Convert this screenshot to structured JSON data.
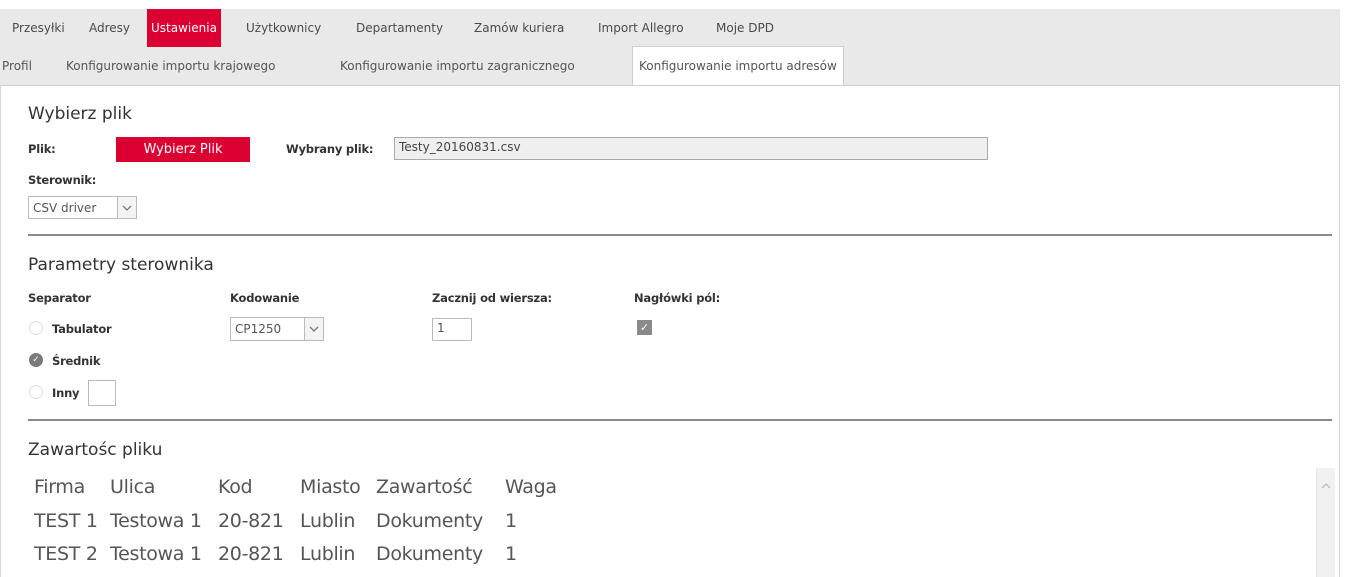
{
  "nav": {
    "items": [
      "Przesyłki",
      "Adresy",
      "Ustawienia",
      "Użytkownicy",
      "Departamenty",
      "Zamów kuriera",
      "Import Allegro",
      "Moje DPD"
    ],
    "active": "Ustawienia",
    "active_color": "#dc0032"
  },
  "subnav": {
    "items": [
      "Profil",
      "Konfigurowanie importu krajowego",
      "Konfigurowanie importu zagranicznego",
      "Konfigurowanie importu adresów"
    ],
    "active": "Konfigurowanie importu adresów"
  },
  "file_section": {
    "title": "Wybierz plik",
    "file_label": "Plik:",
    "choose_button": "Wybierz Plik",
    "selected_label": "Wybrany plik:",
    "selected_value": "Testy_20160831.csv",
    "driver_label": "Sterownik:",
    "driver_value": "CSV driver"
  },
  "params": {
    "title": "Parametry sterownika",
    "separator_label": "Separator",
    "separators": [
      {
        "label": "Tabulator",
        "checked": false
      },
      {
        "label": "Średnik",
        "checked": true
      },
      {
        "label": "Inny",
        "checked": false
      }
    ],
    "encoding_label": "Kodowanie",
    "encoding_value": "CP1250",
    "start_row_label": "Zacznij od wiersza:",
    "start_row_value": "1",
    "headers_label": "Nagłówki pól:",
    "headers_checked": true
  },
  "contents": {
    "title": "Zawartośc pliku",
    "columns": [
      "Firma",
      "Ulica",
      "Kod",
      "Miasto",
      "Zawartość",
      "Waga"
    ],
    "rows": [
      [
        "TEST 1",
        "Testowa 1",
        "20-821",
        "Lublin",
        "Dokumenty",
        "1"
      ],
      [
        "TEST 2",
        "Testowa 1",
        "20-821",
        "Lublin",
        "Dokumenty",
        "1"
      ]
    ]
  },
  "icons": {
    "dropdown": "chevron-down-icon",
    "scroll_up": "chevron-up-icon",
    "check": "check-icon"
  }
}
